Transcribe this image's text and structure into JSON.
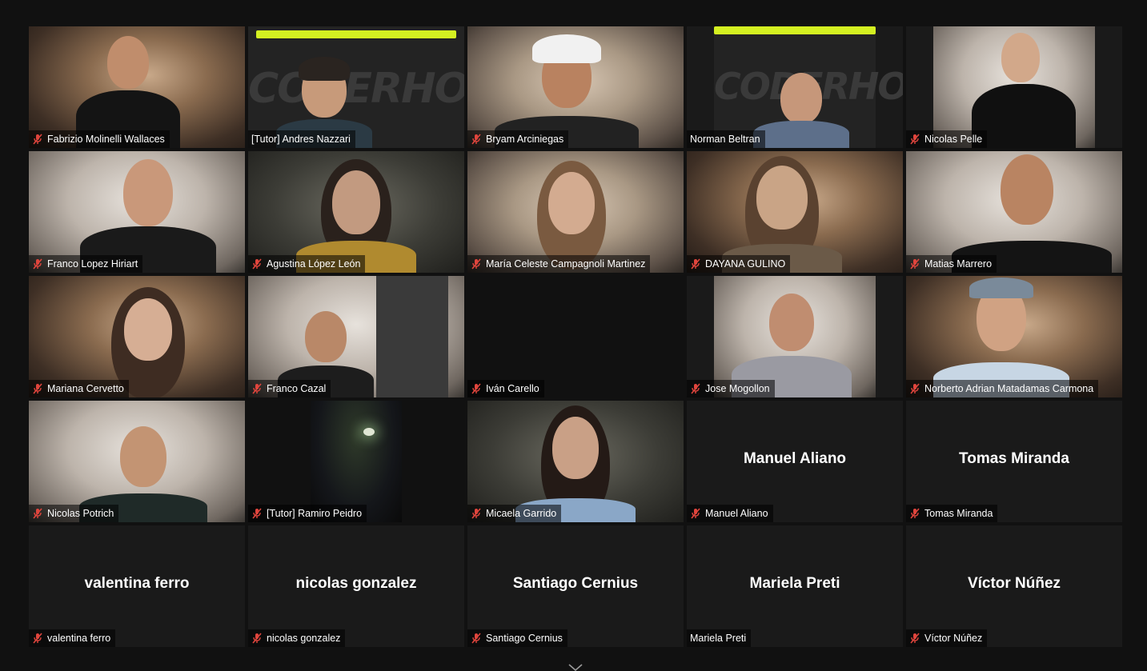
{
  "meeting": {
    "highlight_color": "#d6f06a",
    "slide_text": "CODERHOUSE",
    "participants": [
      {
        "name": "Fabrizio Molinelli Wallaces",
        "muted": true,
        "video": true
      },
      {
        "name": "[Tutor] Andres Nazzari",
        "muted": false,
        "video": true,
        "active_speaker": true
      },
      {
        "name": "Bryam Arciniegas",
        "muted": true,
        "video": true
      },
      {
        "name": "Norman Beltran",
        "muted": false,
        "video": true
      },
      {
        "name": "Nicolas Pelle",
        "muted": true,
        "video": true
      },
      {
        "name": "Franco Lopez Hiriart",
        "muted": true,
        "video": true
      },
      {
        "name": "Agustina López León",
        "muted": true,
        "video": true
      },
      {
        "name": "María Celeste Campagnoli Martinez",
        "muted": true,
        "video": true
      },
      {
        "name": "DAYANA GULINO",
        "muted": true,
        "video": true
      },
      {
        "name": "Matias Marrero",
        "muted": true,
        "video": true
      },
      {
        "name": "Mariana Cervetto",
        "muted": true,
        "video": true
      },
      {
        "name": "Franco Cazal",
        "muted": true,
        "video": true
      },
      {
        "name": "Iván Carello",
        "muted": true,
        "video": false
      },
      {
        "name": "Jose Mogollon",
        "muted": true,
        "video": true
      },
      {
        "name": "Norberto Adrian Matadamas Carmona",
        "muted": true,
        "video": true
      },
      {
        "name": "Nicolas Potrich",
        "muted": true,
        "video": true
      },
      {
        "name": "[Tutor] Ramiro Peidro",
        "muted": true,
        "video": true
      },
      {
        "name": "Micaela Garrido",
        "muted": true,
        "video": true
      },
      {
        "name": "Manuel Aliano",
        "muted": true,
        "video": false
      },
      {
        "name": "Tomas Miranda",
        "muted": true,
        "video": false
      },
      {
        "name": "valentina ferro",
        "muted": true,
        "video": false
      },
      {
        "name": "nicolas gonzalez",
        "muted": true,
        "video": false
      },
      {
        "name": "Santiago Cernius",
        "muted": true,
        "video": false
      },
      {
        "name": "Mariela Preti",
        "muted": false,
        "video": false
      },
      {
        "name": "Víctor Núñez",
        "muted": true,
        "video": false
      }
    ]
  }
}
